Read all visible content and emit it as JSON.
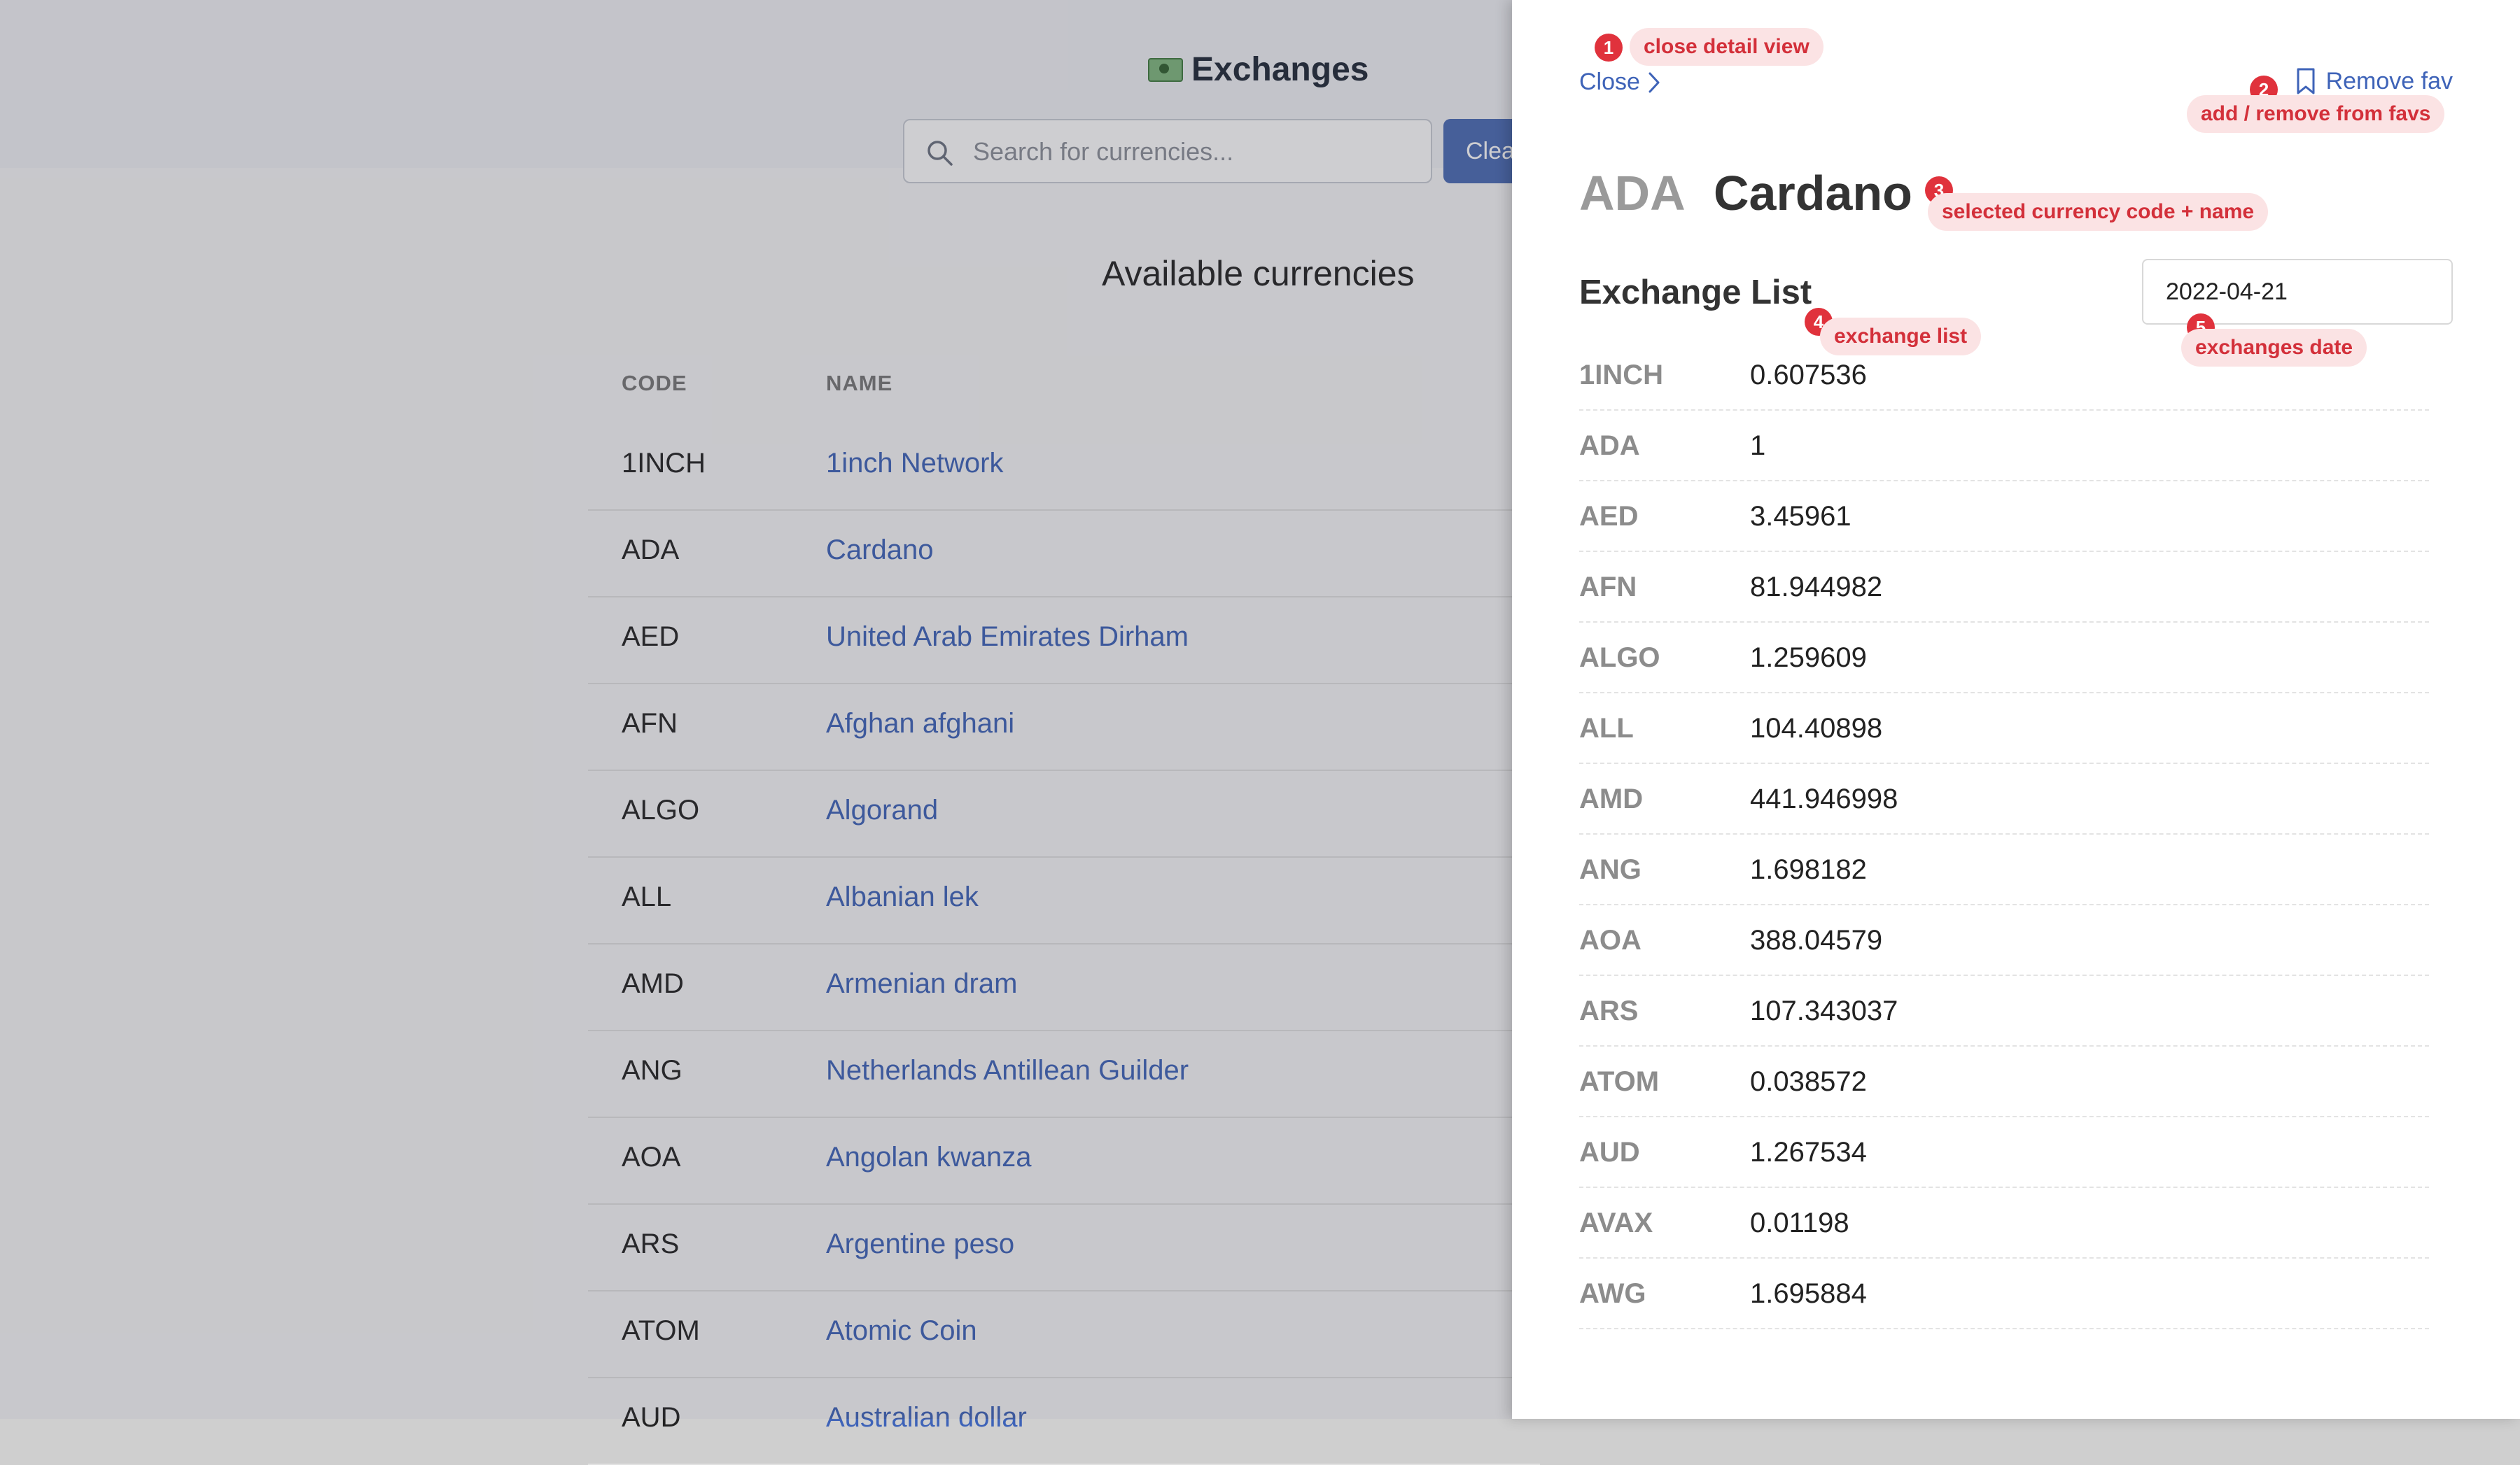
{
  "app": {
    "title": "Exchanges",
    "search_placeholder": "Search for currencies...",
    "clear_label": "Clea",
    "table_title": "Available currencies",
    "columns": [
      "CODE",
      "NAME"
    ],
    "rows": [
      {
        "code": "1INCH",
        "name": "1inch Network"
      },
      {
        "code": "ADA",
        "name": "Cardano"
      },
      {
        "code": "AED",
        "name": "United Arab Emirates Dirham"
      },
      {
        "code": "AFN",
        "name": "Afghan afghani"
      },
      {
        "code": "ALGO",
        "name": "Algorand"
      },
      {
        "code": "ALL",
        "name": "Albanian lek"
      },
      {
        "code": "AMD",
        "name": "Armenian dram"
      },
      {
        "code": "ANG",
        "name": "Netherlands Antillean Guilder"
      },
      {
        "code": "AOA",
        "name": "Angolan kwanza"
      },
      {
        "code": "ARS",
        "name": "Argentine peso"
      },
      {
        "code": "ATOM",
        "name": "Atomic Coin"
      },
      {
        "code": "AUD",
        "name": "Australian dollar"
      }
    ]
  },
  "panel": {
    "close_label": "Close",
    "fav_label": "Remove fav",
    "selected_code": "ADA",
    "selected_name": "Cardano",
    "exchange_title": "Exchange List",
    "date_value": "2022-04-21",
    "exchanges": [
      {
        "code": "1INCH",
        "value": "0.607536"
      },
      {
        "code": "ADA",
        "value": "1"
      },
      {
        "code": "AED",
        "value": "3.45961"
      },
      {
        "code": "AFN",
        "value": "81.944982"
      },
      {
        "code": "ALGO",
        "value": "1.259609"
      },
      {
        "code": "ALL",
        "value": "104.40898"
      },
      {
        "code": "AMD",
        "value": "441.946998"
      },
      {
        "code": "ANG",
        "value": "1.698182"
      },
      {
        "code": "AOA",
        "value": "388.04579"
      },
      {
        "code": "ARS",
        "value": "107.343037"
      },
      {
        "code": "ATOM",
        "value": "0.038572"
      },
      {
        "code": "AUD",
        "value": "1.267534"
      },
      {
        "code": "AVAX",
        "value": "0.01198"
      },
      {
        "code": "AWG",
        "value": "1.695884"
      }
    ]
  },
  "annotations": [
    {
      "num": "1",
      "label": "close detail view"
    },
    {
      "num": "2",
      "label": "add / remove from favs"
    },
    {
      "num": "3",
      "label": "selected currency code + name"
    },
    {
      "num": "4",
      "label": "exchange list"
    },
    {
      "num": "5",
      "label": "exchanges date"
    }
  ],
  "colors": {
    "accent": "#3e63b8",
    "annotation": "#e0323c",
    "button": "#4a6bb5"
  },
  "icons": [
    "money-icon",
    "search-icon",
    "chevron-right-icon",
    "bookmark-icon"
  ]
}
